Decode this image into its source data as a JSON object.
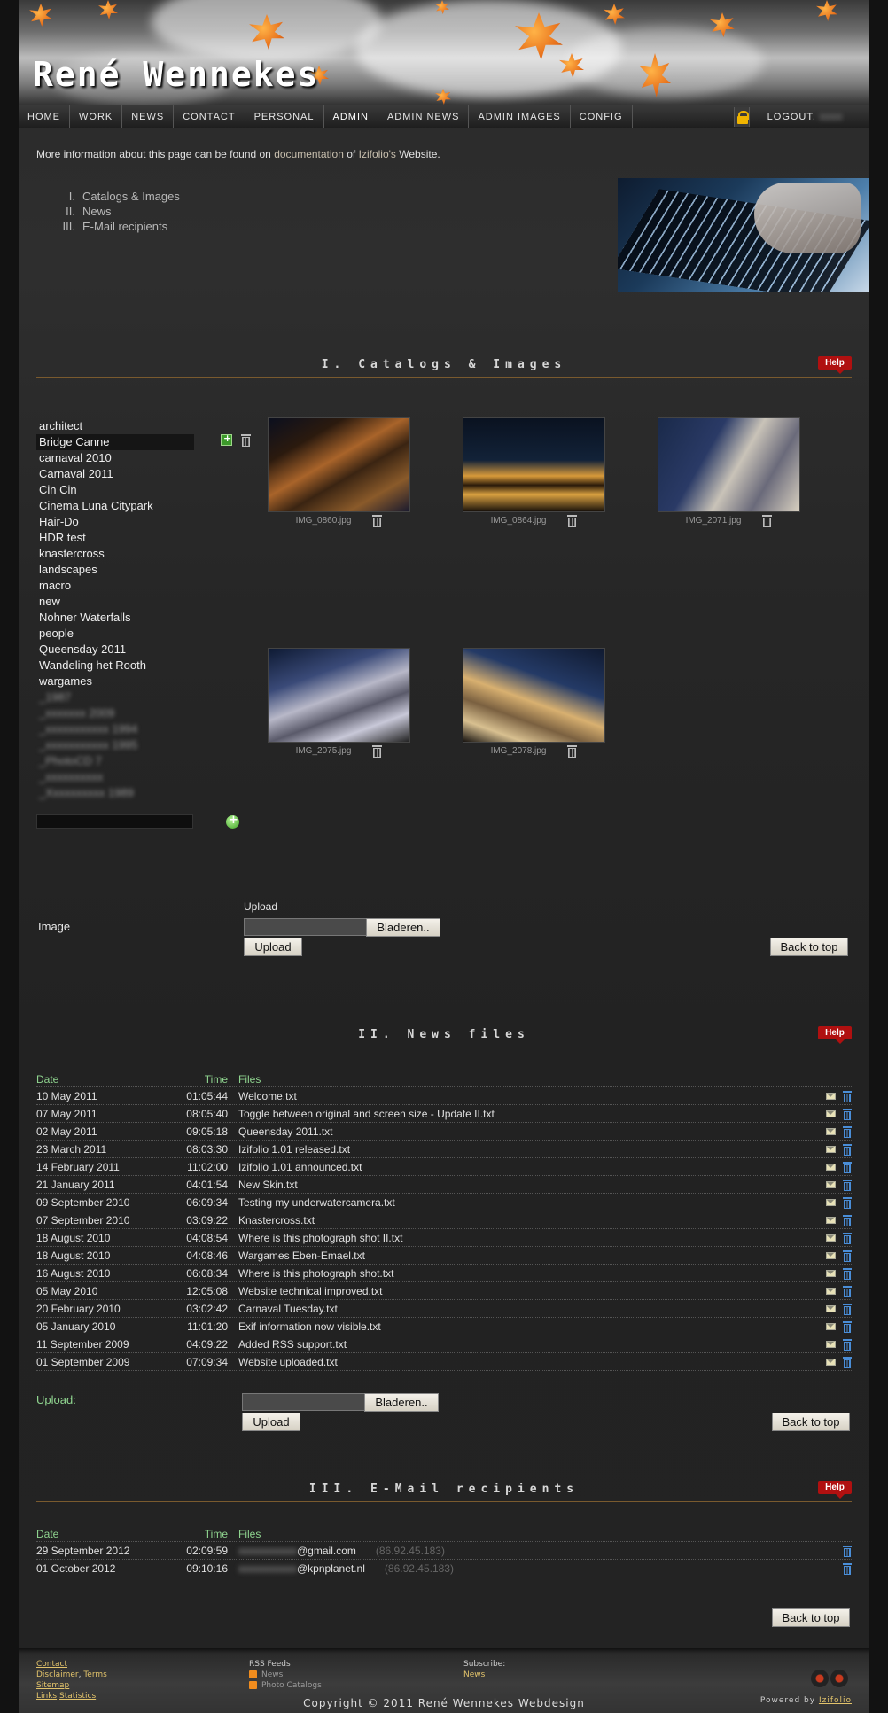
{
  "site": {
    "title": "René Wennekes"
  },
  "nav": {
    "items": [
      "HOME",
      "WORK",
      "NEWS",
      "CONTACT",
      "PERSONAL",
      "ADMIN",
      "ADMIN NEWS",
      "ADMIN IMAGES",
      "CONFIG"
    ],
    "logout_label": "LOGOUT,"
  },
  "intro": {
    "prefix": "More information about this page can be found on ",
    "link1": "documentation",
    "mid": " of ",
    "link2": "Izifolio's",
    "suffix": " Website."
  },
  "toc": [
    {
      "num": "I.",
      "label": "Catalogs & Images"
    },
    {
      "num": "II.",
      "label": "News"
    },
    {
      "num": "III.",
      "label": "E-Mail recipients"
    }
  ],
  "sections": {
    "catalogs_title": "I.  Catalogs & Images",
    "news_title": "II.  News files",
    "email_title": "III.  E-Mail recipients",
    "help_label": "Help"
  },
  "catalogs": [
    "architect",
    "Bridge Canne",
    "carnaval 2010",
    "Carnaval 2011",
    "Cin Cin",
    "Cinema Luna Citypark",
    "Hair-Do",
    "HDR test",
    "knastercross",
    "landscapes",
    "macro",
    "new",
    "Nohner Waterfalls",
    "people",
    "Queensday 2011",
    "Wandeling het Rooth",
    "wargames"
  ],
  "selected_catalog": "Bridge Canne",
  "images": [
    {
      "file": "IMG_0860.jpg",
      "c1": "#2b1a0e",
      "c2": "#a9642a"
    },
    {
      "file": "IMG_0864.jpg",
      "c1": "#0a1220",
      "c2": "#d89a3a"
    },
    {
      "file": "IMG_2071.jpg",
      "c1": "#1a2a4a",
      "c2": "#c9c3b8"
    },
    {
      "file": "IMG_2075.jpg",
      "c1": "#0e1a33",
      "c2": "#b8b8c8"
    },
    {
      "file": "IMG_2078.jpg",
      "c1": "#101a30",
      "c2": "#d8b070"
    }
  ],
  "image_upload": {
    "row_label": "Image",
    "caption": "Upload",
    "browse_label": "Bladeren..",
    "upload_label": "Upload",
    "back_to_top": "Back to top"
  },
  "news": {
    "headers": {
      "date": "Date",
      "time": "Time",
      "files": "Files"
    },
    "rows": [
      {
        "date": "10 May 2011",
        "time": "01:05:44",
        "file": "Welcome.txt"
      },
      {
        "date": "07 May 2011",
        "time": "08:05:40",
        "file": "Toggle between original and screen size - Update II.txt"
      },
      {
        "date": "02 May 2011",
        "time": "09:05:18",
        "file": "Queensday 2011.txt"
      },
      {
        "date": "23 March 2011",
        "time": "08:03:30",
        "file": "Izifolio 1.01 released.txt"
      },
      {
        "date": "14 February 2011",
        "time": "11:02:00",
        "file": "Izifolio 1.01 announced.txt"
      },
      {
        "date": "21 January 2011",
        "time": "04:01:54",
        "file": "New Skin.txt"
      },
      {
        "date": "09 September 2010",
        "time": "06:09:34",
        "file": "Testing my underwatercamera.txt"
      },
      {
        "date": "07 September 2010",
        "time": "03:09:22",
        "file": "Knastercross.txt"
      },
      {
        "date": "18 August 2010",
        "time": "04:08:54",
        "file": "Where is this photograph shot II.txt"
      },
      {
        "date": "18 August 2010",
        "time": "04:08:46",
        "file": "Wargames Eben-Emael.txt"
      },
      {
        "date": "16 August 2010",
        "time": "06:08:34",
        "file": "Where is this photograph shot.txt"
      },
      {
        "date": "05 May 2010",
        "time": "12:05:08",
        "file": "Website technical improved.txt"
      },
      {
        "date": "20 February 2010",
        "time": "03:02:42",
        "file": "Carnaval Tuesday.txt"
      },
      {
        "date": "05 January 2010",
        "time": "11:01:20",
        "file": "Exif information now visible.txt"
      },
      {
        "date": "11 September 2009",
        "time": "04:09:22",
        "file": "Added RSS support.txt"
      },
      {
        "date": "01 September 2009",
        "time": "07:09:34",
        "file": "Website uploaded.txt"
      }
    ],
    "upload_label": "Upload:",
    "browse_label": "Bladeren..",
    "upload_button": "Upload",
    "back_to_top": "Back to top"
  },
  "emails": {
    "headers": {
      "date": "Date",
      "time": "Time",
      "files": "Files"
    },
    "rows": [
      {
        "date": "29 September 2012",
        "time": "02:09:59",
        "domain": "@gmail.com",
        "ip": "(86.92.45.183)"
      },
      {
        "date": "01 October 2012",
        "time": "09:10:16",
        "domain": "@kpnplanet.nl",
        "ip": "(86.92.45.183)"
      }
    ],
    "back_to_top": "Back to top"
  },
  "footer": {
    "links_col": [
      "Contact",
      "Disclaimer",
      "Terms",
      "Sitemap",
      "Links",
      "Statistics"
    ],
    "rss_title": "RSS Feeds",
    "rss_items": [
      "News",
      "Photo Catalogs"
    ],
    "subscribe_title": "Subscribe:",
    "subscribe_link": "News",
    "copyright": "Copyright © 2011 René Wennekes Webdesign",
    "powered_by": "Powered by ",
    "powered_link": "Izifolio"
  }
}
